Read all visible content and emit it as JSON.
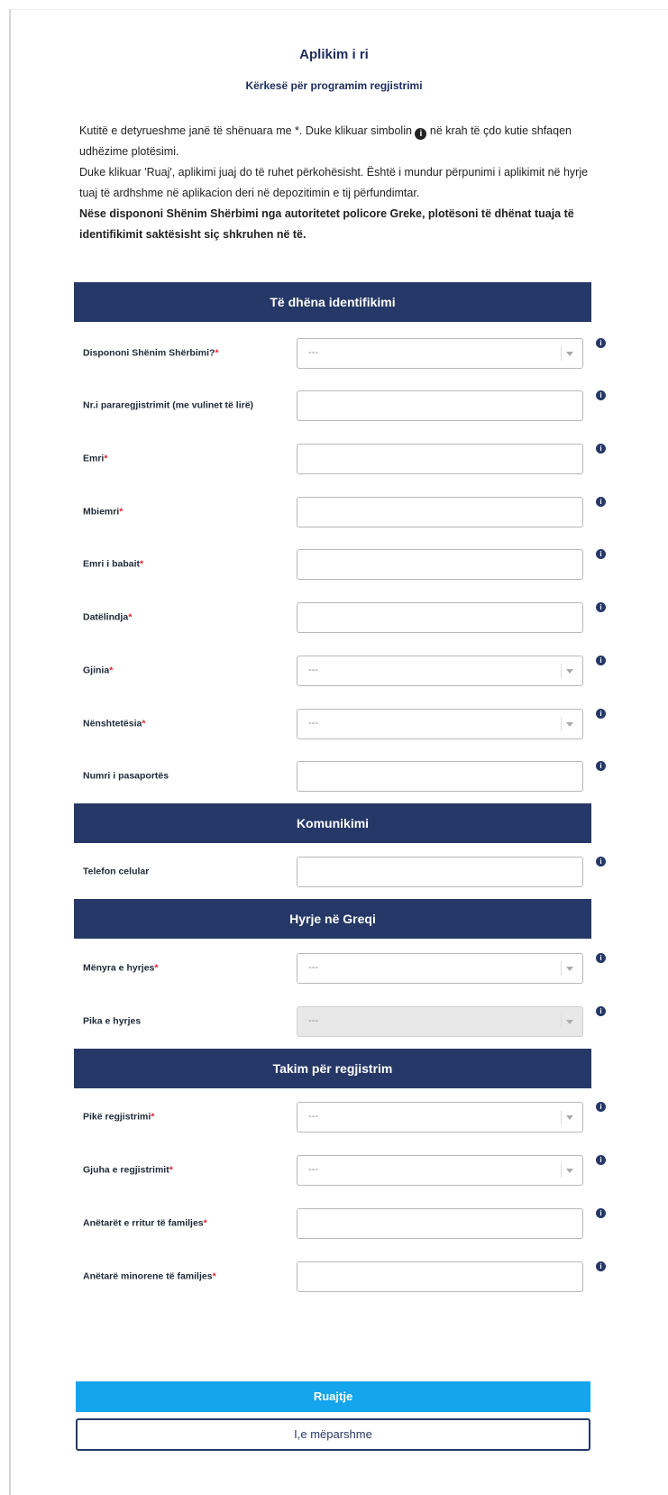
{
  "header": {
    "title": "Aplikim i ri",
    "subtitle": "Kërkesë për programim regjistrimi"
  },
  "intro": {
    "line1a": "Kutitë e detyrueshme janë të shënuara me *. Duke klikuar simbolin",
    "line1b": "në krah të çdo kutie shfaqen udhëzime plotësimi.",
    "line2": "Duke klikuar 'Ruaj', aplikimi juaj do të ruhet përkohësisht. Është i mundur përpunimi i aplikimit në hyrje tuaj të ardhshme në aplikacion deri në depozitimin e tij përfundimtar.",
    "bold": "Nëse dispononi Shënim Shërbimi nga autoritetet policore Greke, plotësoni të dhënat tuaja të identifikimit saktësisht siç shkruhen në të."
  },
  "sections": {
    "identification": "Të dhëna identifikimi",
    "communication": "Komunikimi",
    "entry": "Hyrje në Greqi",
    "appointment": "Takim për regjistrim"
  },
  "fields": {
    "service_note": {
      "label": "Dispononi Shënim Shërbimi?",
      "value": "---"
    },
    "prereg_number": {
      "label": "Nr.i pararegjistrimit (me vulinet të lirë)"
    },
    "first_name": {
      "label": "Emri"
    },
    "last_name": {
      "label": "Mbiemri"
    },
    "father_name": {
      "label": "Emri i babait"
    },
    "birth_date": {
      "label": "Datëlindja"
    },
    "gender": {
      "label": "Gjinia",
      "value": "---"
    },
    "nationality": {
      "label": "Nënshtetësia",
      "value": "---"
    },
    "passport_number": {
      "label": "Numri i pasaportës"
    },
    "mobile_phone": {
      "label": "Telefon celular"
    },
    "entry_method": {
      "label": "Mënyra e hyrjes",
      "value": "---"
    },
    "entry_point": {
      "label": "Pika e hyrjes",
      "value": "---"
    },
    "registration_point": {
      "label": "Pikë regjistrimi",
      "value": "---"
    },
    "registration_language": {
      "label": "Gjuha e regjistrimit",
      "value": "---"
    },
    "adult_family_members": {
      "label": "Anëtarët e rritur të familjes"
    },
    "minor_family_members": {
      "label": "Anëtarë minorene të familjes"
    }
  },
  "required_mark": "*",
  "info_glyph": "i",
  "buttons": {
    "save": "Ruajtje",
    "previous": "I,e mëparshme"
  },
  "colors": {
    "section_bar": "#253867",
    "save_button": "#14a5ec",
    "required": "#e31c2b"
  }
}
